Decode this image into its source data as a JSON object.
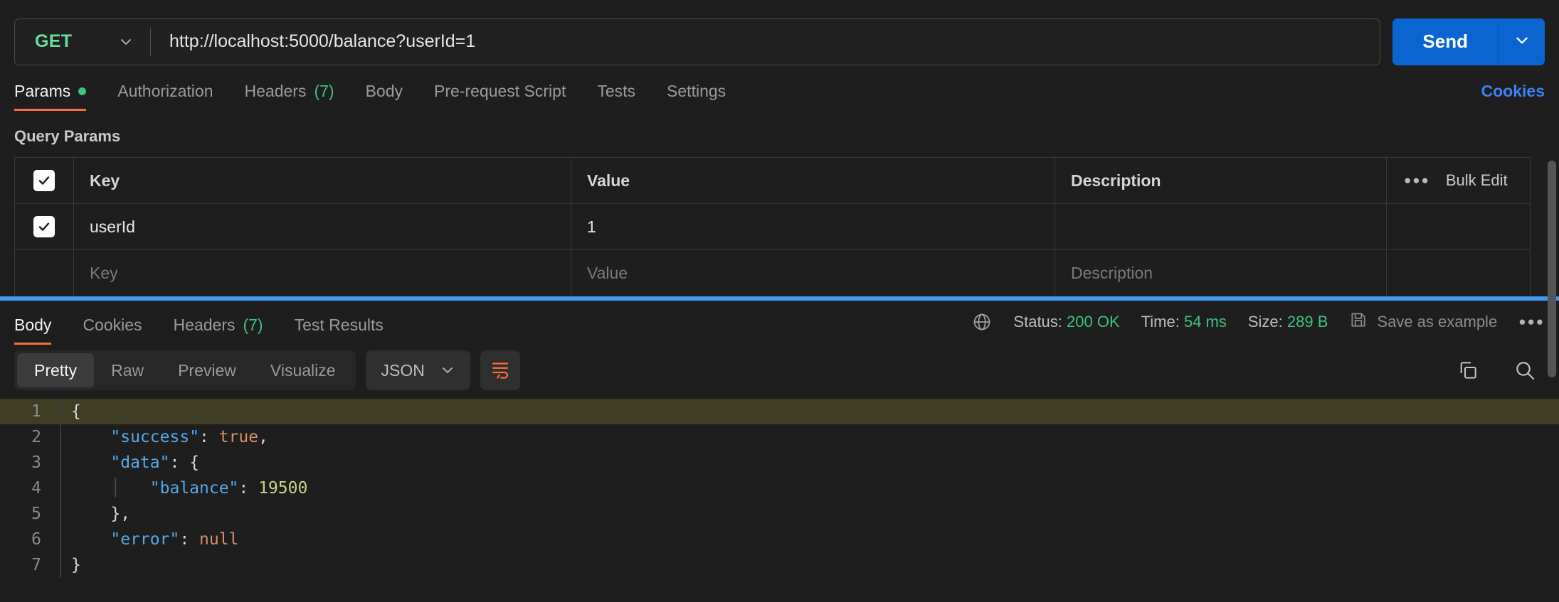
{
  "request": {
    "method": "GET",
    "url": "http://localhost:5000/balance?userId=1",
    "send_label": "Send",
    "tabs": [
      {
        "label": "Params",
        "badge": "",
        "dot": true,
        "active": true
      },
      {
        "label": "Authorization",
        "badge": "",
        "dot": false,
        "active": false
      },
      {
        "label": "Headers",
        "badge": "(7)",
        "dot": false,
        "active": false
      },
      {
        "label": "Body",
        "badge": "",
        "dot": false,
        "active": false
      },
      {
        "label": "Pre-request Script",
        "badge": "",
        "dot": false,
        "active": false
      },
      {
        "label": "Tests",
        "badge": "",
        "dot": false,
        "active": false
      },
      {
        "label": "Settings",
        "badge": "",
        "dot": false,
        "active": false
      }
    ],
    "cookies_link": "Cookies"
  },
  "params": {
    "section_title": "Query Params",
    "headers": {
      "key": "Key",
      "value": "Value",
      "description": "Description"
    },
    "bulk_edit_label": "Bulk Edit",
    "rows": [
      {
        "checked": true,
        "key": "userId",
        "value": "1",
        "description": ""
      }
    ],
    "placeholder_row": {
      "key": "Key",
      "value": "Value",
      "description": "Description"
    }
  },
  "response": {
    "tabs": [
      {
        "label": "Body",
        "badge": "",
        "active": true
      },
      {
        "label": "Cookies",
        "badge": "",
        "active": false
      },
      {
        "label": "Headers",
        "badge": "(7)",
        "active": false
      },
      {
        "label": "Test Results",
        "badge": "",
        "active": false
      }
    ],
    "status_label": "Status:",
    "status_value": "200 OK",
    "time_label": "Time:",
    "time_value": "54 ms",
    "size_label": "Size:",
    "size_value": "289 B",
    "save_as_example": "Save as example",
    "format_tabs": [
      {
        "label": "Pretty",
        "active": true
      },
      {
        "label": "Raw",
        "active": false
      },
      {
        "label": "Preview",
        "active": false
      },
      {
        "label": "Visualize",
        "active": false
      }
    ],
    "language": "JSON",
    "body_lines": [
      {
        "num": "1",
        "highlight": true,
        "indent": 0,
        "guide": false,
        "tokens": [
          {
            "t": "{",
            "c": "br"
          }
        ]
      },
      {
        "num": "2",
        "highlight": false,
        "indent": 1,
        "guide": false,
        "tokens": [
          {
            "t": "\"success\"",
            "c": "k"
          },
          {
            "t": ": ",
            "c": "p"
          },
          {
            "t": "true",
            "c": "b"
          },
          {
            "t": ",",
            "c": "p"
          }
        ]
      },
      {
        "num": "3",
        "highlight": false,
        "indent": 1,
        "guide": false,
        "tokens": [
          {
            "t": "\"data\"",
            "c": "k"
          },
          {
            "t": ": ",
            "c": "p"
          },
          {
            "t": "{",
            "c": "br"
          }
        ]
      },
      {
        "num": "4",
        "highlight": false,
        "indent": 2,
        "guide": true,
        "tokens": [
          {
            "t": "\"balance\"",
            "c": "k"
          },
          {
            "t": ": ",
            "c": "p"
          },
          {
            "t": "19500",
            "c": "n"
          }
        ]
      },
      {
        "num": "5",
        "highlight": false,
        "indent": 1,
        "guide": false,
        "tokens": [
          {
            "t": "}",
            "c": "br"
          },
          {
            "t": ",",
            "c": "p"
          }
        ]
      },
      {
        "num": "6",
        "highlight": false,
        "indent": 1,
        "guide": false,
        "tokens": [
          {
            "t": "\"error\"",
            "c": "k"
          },
          {
            "t": ": ",
            "c": "p"
          },
          {
            "t": "null",
            "c": "b"
          }
        ]
      },
      {
        "num": "7",
        "highlight": false,
        "indent": 0,
        "guide": false,
        "tokens": [
          {
            "t": "}",
            "c": "br"
          }
        ]
      }
    ]
  },
  "colors": {
    "accent_orange": "#ff6c37",
    "send_blue": "#0b65d0",
    "status_green": "#3cc37f",
    "method_green": "#6bdd9a",
    "link_blue": "#3b82f6",
    "splitter_blue": "#3f9bf0"
  }
}
